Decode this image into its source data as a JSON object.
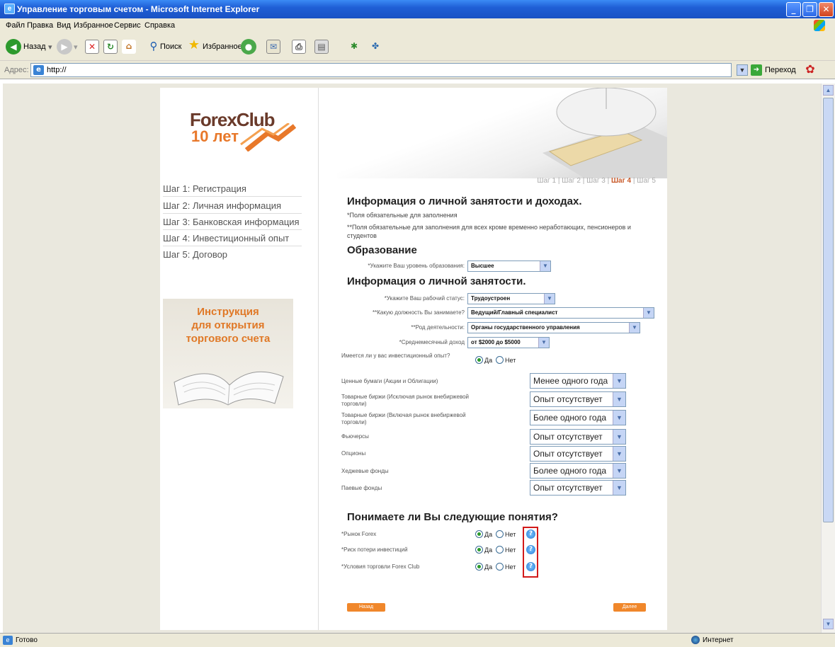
{
  "window": {
    "title": "Управление торговым счетом - Microsoft Internet Explorer"
  },
  "menu": [
    "Файл",
    "Правка",
    "Вид",
    "Избранное",
    "Сервис",
    "Справка"
  ],
  "toolbar": {
    "back": "Назад",
    "search": "Поиск",
    "favorites": "Избранное"
  },
  "address": {
    "label": "Адрес:",
    "value": "http://",
    "go": "Переход"
  },
  "left": {
    "logo_name": "ForexClub",
    "logo_years": "10 лет",
    "steps": [
      "Шаг 1: Регистрация",
      "Шаг 2: Личная информация",
      "Шаг 3: Банковская информация",
      "Шаг 4: Инвестиционный опыт",
      "Шаг 5: Договор"
    ],
    "banner": [
      "Инструкция",
      "для открытия",
      "торгового счета"
    ]
  },
  "nav": {
    "s1": "Шаг 1",
    "s2": "Шаг 2",
    "s3": "Шаг 3",
    "s4": "Шаг 4",
    "s5": "Шаг 5",
    "sep": "|"
  },
  "form": {
    "title": "Информация о личной занятости и доходах.",
    "note1": "*Поля обязательные для заполнения",
    "note2": "**Поля обязательные для заполнения для всех кроме временно неработающих, пенсионеров и студентов",
    "edu_heading": "Образование",
    "edu_label": "*Укажите Ваш уровень образования:",
    "edu_value": "Высшее",
    "emp_heading": "Информация о личной занятости.",
    "status_label": "*Укажите Ваш рабочий статус:",
    "status_value": "Трудоустроен",
    "position_label": "**Какую должность Вы занимаете?",
    "position_value": "Ведущий/Главный специалист",
    "activity_label": "**Род деятельности:",
    "activity_value": "Органы государственного управления",
    "income_label": "*Среднемесячный доход",
    "income_value": "от $2000 до $5000",
    "invest_q": "Имеется ли у вас инвестиционный опыт?",
    "yes": "Да",
    "no": "Нет",
    "experience": [
      {
        "label": "Ценные бумаги (Акции и Облигации)",
        "value": "Менее одного года"
      },
      {
        "label": "Товарные биржи (Исключая рынок внебиржевой торговли)",
        "value": "Опыт отсутствует"
      },
      {
        "label": "Товарные биржи (Включая рынок внебиржевой торговли)",
        "value": "Более одного года"
      },
      {
        "label": "Фьючерсы",
        "value": "Опыт отсутствует"
      },
      {
        "label": "Опционы",
        "value": "Опыт отсутствует"
      },
      {
        "label": "Хеджевые фонды",
        "value": "Более одного года"
      },
      {
        "label": "Паевые фонды",
        "value": "Опыт отсутствует"
      }
    ],
    "concepts_heading": "Понимаете ли Вы следующие понятия?",
    "concepts": [
      "*Рынок Forex",
      "*Риск потери инвестиций",
      "*Условия торговли Forex Club"
    ],
    "back_btn": "Назад",
    "next_btn": "Далее"
  },
  "status": {
    "text": "Готово",
    "zone": "Интернет"
  },
  "colors": {
    "accent": "#f0872b",
    "brand": "#ad4f31",
    "highlight": "#d21a1a",
    "title_bar": "#1f5fd6"
  }
}
